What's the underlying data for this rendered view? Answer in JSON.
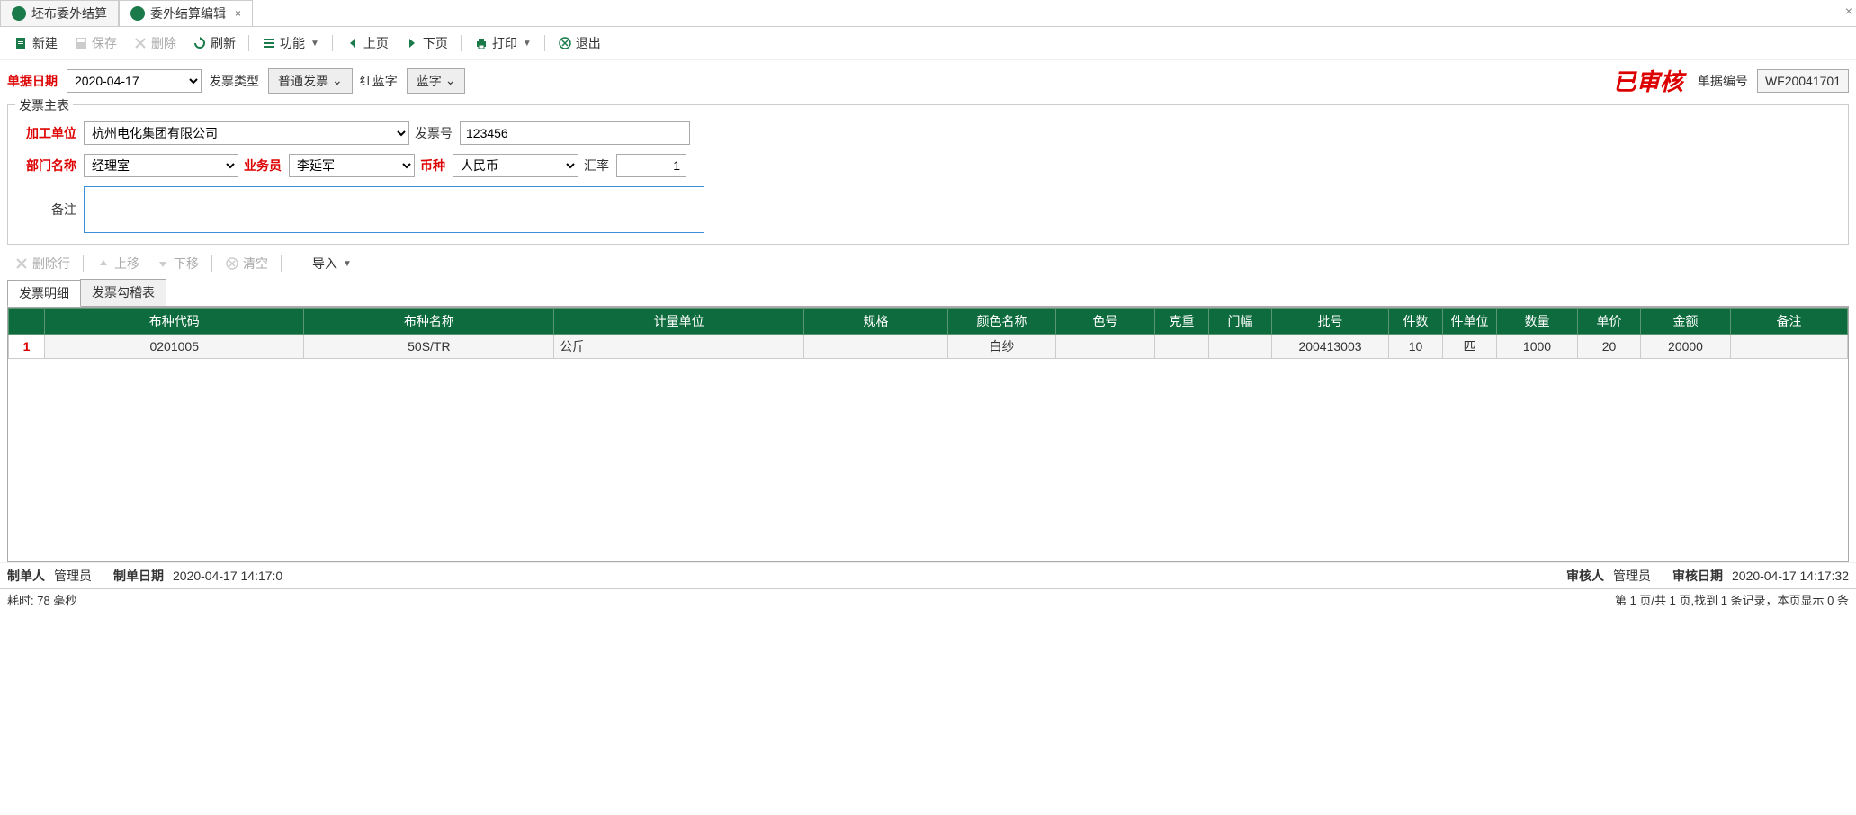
{
  "tabs": {
    "tab1": "坯布委外结算",
    "tab2": "委外结算编辑"
  },
  "toolbar": {
    "new": "新建",
    "save": "保存",
    "delete": "删除",
    "refresh": "刷新",
    "func": "功能",
    "prev": "上页",
    "next": "下页",
    "print": "打印",
    "exit": "退出"
  },
  "top": {
    "billdate_lbl": "单据日期",
    "billdate": "2020-04-17",
    "invtype_lbl": "发票类型",
    "invtype": "普通发票",
    "redblue_lbl": "红蓝字",
    "redblue": "蓝字",
    "audited": "已审核",
    "billno_lbl": "单据编号",
    "billno": "WF20041701"
  },
  "main": {
    "legend": "发票主表",
    "supplier_lbl": "加工单位",
    "supplier": "杭州电化集团有限公司",
    "invno_lbl": "发票号",
    "invno": "123456",
    "dept_lbl": "部门名称",
    "dept": "经理室",
    "sales_lbl": "业务员",
    "sales": "李延军",
    "curr_lbl": "币种",
    "curr": "人民币",
    "rate_lbl": "汇率",
    "rate": "1",
    "remark_lbl": "备注"
  },
  "sub": {
    "delrow": "删除行",
    "up": "上移",
    "down": "下移",
    "clear": "清空",
    "import": "导入"
  },
  "dtabs": {
    "detail": "发票明细",
    "check": "发票勾稽表"
  },
  "cols": {
    "code": "布种代码",
    "name": "布种名称",
    "unit": "计量单位",
    "spec": "规格",
    "colorname": "颜色名称",
    "colorno": "色号",
    "gram": "克重",
    "width": "门幅",
    "lot": "批号",
    "pcs": "件数",
    "pcsunit": "件单位",
    "qty": "数量",
    "price": "单价",
    "amt": "金额",
    "remark": "备注"
  },
  "rows": [
    {
      "idx": "1",
      "code": "0201005",
      "name": "50S/TR",
      "unit": "公斤",
      "spec": "",
      "colorname": "白纱",
      "colorno": "",
      "gram": "",
      "width": "",
      "lot": "200413003",
      "pcs": "10",
      "pcsunit": "匹",
      "qty": "1000",
      "price": "20",
      "amt": "20000",
      "remark": ""
    }
  ],
  "footer": {
    "maker_lbl": "制单人",
    "maker": "管理员",
    "makedate_lbl": "制单日期",
    "makedate": "2020-04-17 14:17:0",
    "auditor_lbl": "审核人",
    "auditor": "管理员",
    "auditdate_lbl": "审核日期",
    "auditdate": "2020-04-17 14:17:32"
  },
  "status": {
    "time": "耗时: 78 毫秒",
    "page": "第 1 页/共 1 页,找到 1 条记录，本页显示 0 条"
  }
}
